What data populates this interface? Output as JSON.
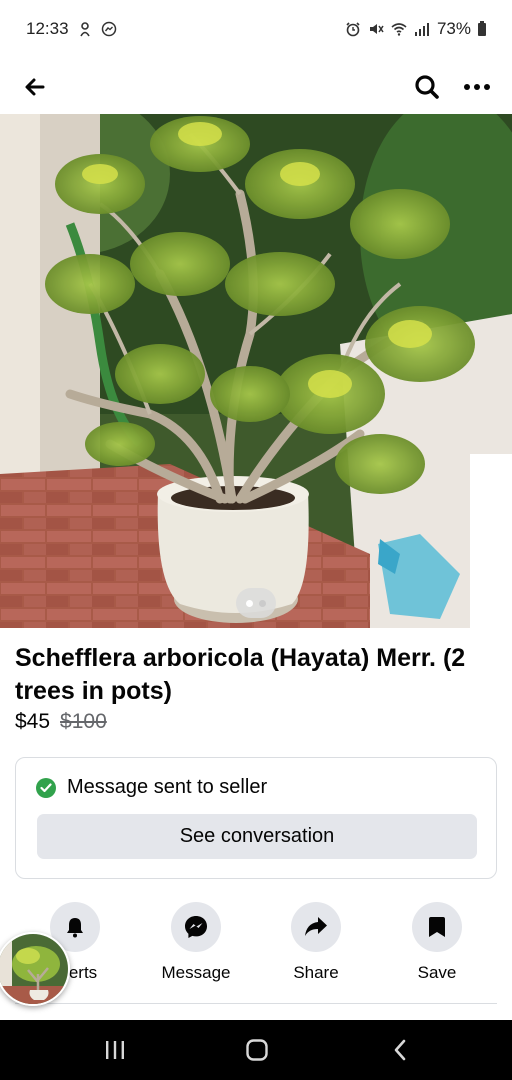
{
  "status_bar": {
    "time": "12:33",
    "battery": "73%",
    "left_icons": [
      "fingerprint-icon",
      "messenger-notification-icon"
    ],
    "right_icons": [
      "alarm-icon",
      "mute-icon",
      "wifi-icon",
      "signal-icon",
      "battery-icon"
    ]
  },
  "header": {
    "back_icon": "arrow-left-icon",
    "search_icon": "search-icon",
    "more_icon": "more-horizontal-icon"
  },
  "listing": {
    "title": "Schefflera arboricola (Hayata) Merr. (2 trees in pots)",
    "price": "$45",
    "original_price": "$100",
    "photo_count": 2,
    "current_photo_index": 1
  },
  "message_card": {
    "status_text": "Message sent to seller",
    "button_label": "See conversation"
  },
  "actions": [
    {
      "label": "Alerts",
      "visible_label": "erts",
      "icon": "bell-icon"
    },
    {
      "label": "Message",
      "icon": "messenger-icon"
    },
    {
      "label": "Share",
      "icon": "share-icon"
    },
    {
      "label": "Save",
      "icon": "bookmark-icon"
    }
  ],
  "colors": {
    "accent_green": "#31a24c",
    "button_gray": "#e4e6eb",
    "text_primary": "#050505",
    "text_secondary": "#65676b"
  },
  "nav_bar": {
    "icons": [
      "recents-icon",
      "home-icon",
      "back-icon"
    ]
  }
}
